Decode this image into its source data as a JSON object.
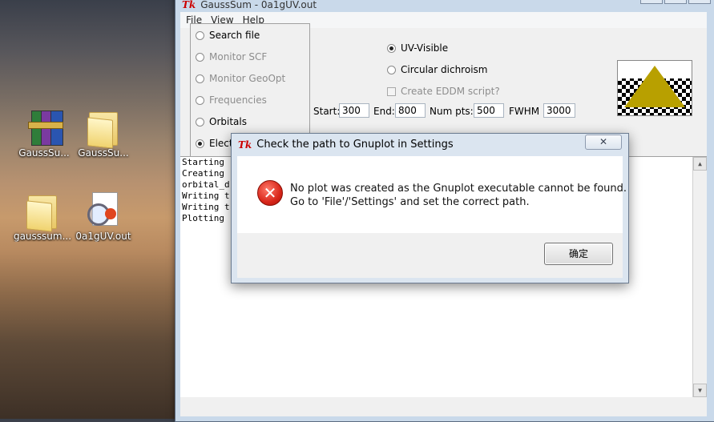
{
  "desktop": {
    "icons": [
      {
        "label": "GaussSu...",
        "icon": "winrar-archive-icon"
      },
      {
        "label": "GaussSu...",
        "icon": "folder-icon"
      },
      {
        "label": "gausssum...",
        "icon": "folder-icon"
      },
      {
        "label": "0a1gUV.out",
        "icon": "out-file-icon"
      }
    ]
  },
  "main_window": {
    "title": "GaussSum - 0a1gUV.out",
    "menu": [
      "File",
      "View",
      "Help"
    ],
    "modes": [
      {
        "label": "Search file",
        "selected": false
      },
      {
        "label": "Monitor SCF",
        "selected": false,
        "disabled": true
      },
      {
        "label": "Monitor GeoOpt",
        "selected": false,
        "disabled": true
      },
      {
        "label": "Frequencies",
        "selected": false,
        "disabled": true
      },
      {
        "label": "Orbitals",
        "selected": false
      },
      {
        "label": "Elect",
        "selected": true
      }
    ],
    "spectrum_options": [
      {
        "label": "UV-Visible",
        "selected": true
      },
      {
        "label": "Circular dichroism",
        "selected": false
      }
    ],
    "eddm_checkbox": {
      "label": "Create EDDM script?",
      "checked": false
    },
    "fields": {
      "start_label": "Start:",
      "start_value": "300",
      "end_label": "End:",
      "end_value": "800",
      "numpts_label": "Num pts:",
      "numpts_value": "500",
      "fwhm_label": "FWHM",
      "fwhm_value": "3000"
    },
    "log_lines": [
      "Starting",
      "Creating",
      "orbital_d",
      "Writing t",
      "Writing t",
      "Plotting"
    ]
  },
  "dialog": {
    "title": "Check the path to Gnuplot in Settings",
    "close_symbol": "✕",
    "message_line1": "No plot was created as the Gnuplot executable cannot be found.",
    "message_line2": "Go to 'File'/'Settings' and set the correct path.",
    "ok_label": "确定"
  }
}
